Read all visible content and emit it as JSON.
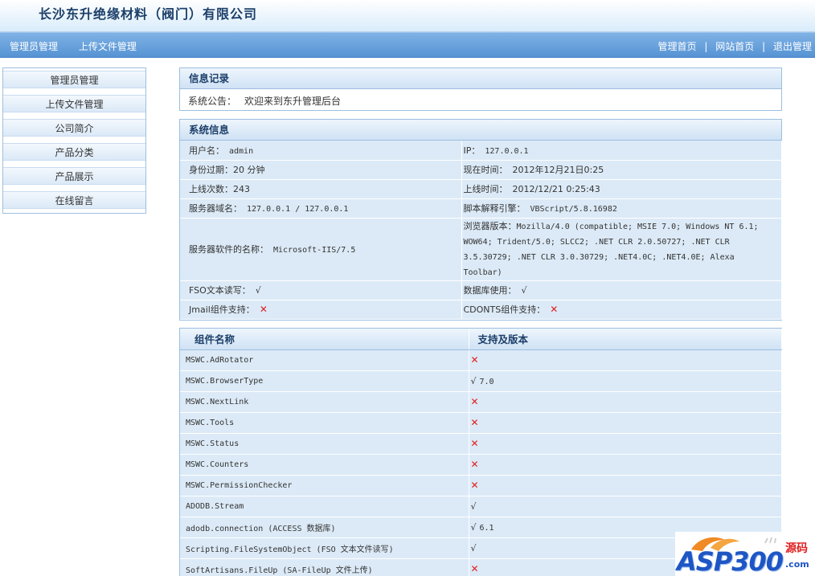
{
  "header": {
    "site_title": "长沙东升绝缘材料（阀门）有限公司"
  },
  "nav": {
    "left": [
      "管理员管理",
      "上传文件管理"
    ],
    "right": [
      "管理首页",
      "网站首页",
      "退出管理"
    ],
    "separator": "|"
  },
  "sidebar": {
    "items": [
      {
        "label": "管理员管理"
      },
      {
        "label": "上传文件管理"
      },
      {
        "label": "公司简介"
      },
      {
        "label": "产品分类"
      },
      {
        "label": "产品展示"
      },
      {
        "label": "在线留言"
      }
    ]
  },
  "info_panel": {
    "title": "信息记录",
    "notice_label": "系统公告：",
    "notice_text": "欢迎来到东升管理后台"
  },
  "system_info": {
    "title": "系统信息",
    "username_label": "用户名：",
    "username": "admin",
    "ip_label": "IP：",
    "ip": "127.0.0.1",
    "expire_label": "身份过期：",
    "expire": "20 分钟",
    "now_label": "现在时间：",
    "now": "2012年12月21日0:25",
    "logins_label": "上线次数：",
    "logins": "243",
    "online_label": "上线时间：",
    "online": "2012/12/21 0:25:43",
    "server_label": "服务器域名：",
    "server": "127.0.0.1 / 127.0.0.1",
    "engine_label": "脚本解释引擎：",
    "engine": "VBScript/5.8.16982",
    "software_label": "服务器软件的名称：",
    "software": "Microsoft-IIS/7.5",
    "browser_label": "浏览器版本：",
    "browser_lines": [
      "Mozilla/4.0 (compatible; MSIE 7.0; Windows NT 6.1;",
      "WOW64; Trident/5.0; SLCC2; .NET CLR 2.0.50727; .NET CLR",
      "3.5.30729; .NET CLR 3.0.30729; .NET4.0C; .NET4.0E; Alexa",
      "Toolbar)"
    ],
    "fso_label": "FSO文本读写：",
    "fso": "√",
    "db_label": "数据库使用：",
    "db": "√",
    "jmail_label": "Jmail组件支持：",
    "jmail": "✕",
    "cdonts_label": "CDONTS组件支持：",
    "cdonts": "✕"
  },
  "components": {
    "col1": "组件名称",
    "col2": "支持及版本",
    "rows": [
      {
        "name": "MSWC.AdRotator",
        "mark": "✕",
        "version": ""
      },
      {
        "name": "MSWC.BrowserType",
        "mark": "√",
        "version": "7.0"
      },
      {
        "name": "MSWC.NextLink",
        "mark": "✕",
        "version": ""
      },
      {
        "name": "MSWC.Tools",
        "mark": "✕",
        "version": ""
      },
      {
        "name": "MSWC.Status",
        "mark": "✕",
        "version": ""
      },
      {
        "name": "MSWC.Counters",
        "mark": "✕",
        "version": ""
      },
      {
        "name": "MSWC.PermissionChecker",
        "mark": "✕",
        "version": ""
      },
      {
        "name": "ADODB.Stream",
        "mark": "√",
        "version": ""
      },
      {
        "name": "adodb.connection (ACCESS 数据库)",
        "mark": "√",
        "version": "6.1"
      },
      {
        "name": "Scripting.FileSystemObject (FSO 文本文件读写)",
        "mark": "√",
        "version": ""
      },
      {
        "name": "SoftArtisans.FileUp (SA-FileUp 文件上传)",
        "mark": "✕",
        "version": ""
      }
    ]
  },
  "watermark": {
    "brand": "ASP300",
    "cn": "源码",
    "domain": ".com"
  }
}
